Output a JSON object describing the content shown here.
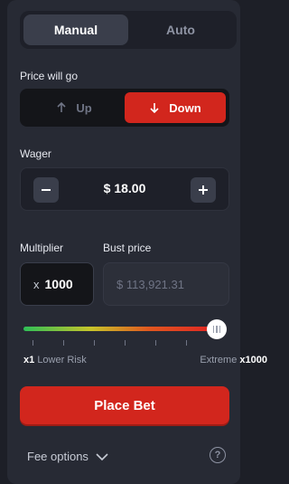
{
  "mode_tabs": {
    "manual": "Manual",
    "auto": "Auto"
  },
  "direction": {
    "label": "Price will go",
    "up": "Up",
    "down": "Down",
    "selected": "down"
  },
  "wager": {
    "label": "Wager",
    "value": "$ 18.00"
  },
  "multiplier": {
    "label": "Multiplier",
    "prefix": "x",
    "value": "1000"
  },
  "bust_price": {
    "label": "Bust price",
    "value": "$ 113,921.31"
  },
  "risk_slider": {
    "min_value": "x1",
    "min_label": "Lower Risk",
    "max_label": "Extreme",
    "max_value": "x1000",
    "level": 1.0
  },
  "place_bet": "Place Bet",
  "fee_options": "Fee options",
  "help": "?",
  "colors": {
    "accent_red": "#d2261d",
    "panel": "#272a34",
    "input_bg": "#1e2029"
  }
}
